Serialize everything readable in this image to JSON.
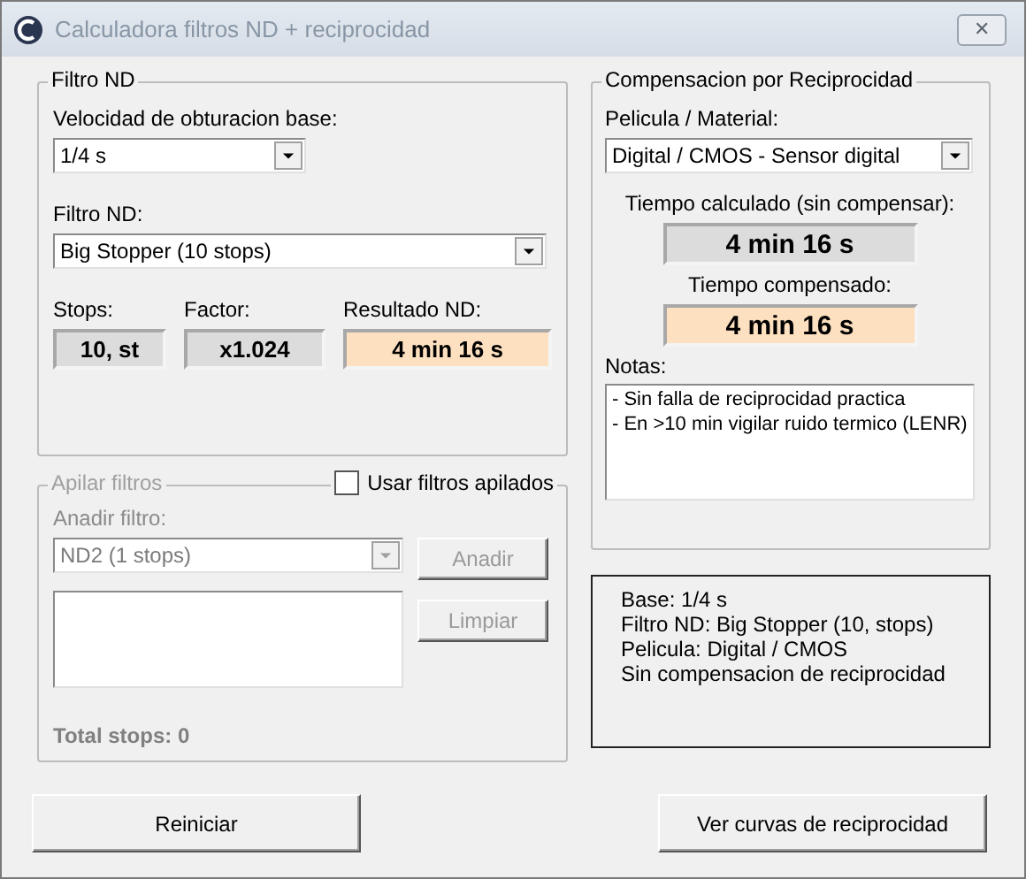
{
  "window": {
    "title": "Calculadora filtros ND + reciprocidad",
    "close": "✕"
  },
  "nd_group": {
    "title": "Filtro ND",
    "shutter_label": "Velocidad de obturacion base:",
    "shutter_value": "1/4 s",
    "filter_label": "Filtro ND:",
    "filter_value": "Big Stopper (10 stops)",
    "outputs": [
      {
        "label": "Stops:",
        "value": "10, st",
        "highlight": false
      },
      {
        "label": "Factor:",
        "value": "x1.024",
        "highlight": false
      },
      {
        "label": "Resultado ND:",
        "value": "4 min 16 s",
        "highlight": true
      }
    ]
  },
  "stack_group": {
    "title": "Apilar filtros",
    "disabled": true,
    "use_checkbox": {
      "label": "Usar filtros apilados",
      "checked": false
    },
    "add_label": "Anadir filtro:",
    "add_value": "ND2 (1 stops)",
    "add_button": "Anadir",
    "clear_button": "Limpiar",
    "total": "Total stops: 0"
  },
  "recip_group": {
    "title": "Compensacion por Reciprocidad",
    "film_label": "Pelicula / Material:",
    "film_value": "Digital / CMOS - Sensor digital",
    "times": [
      {
        "label": "Tiempo calculado (sin compensar):",
        "value": "4 min 16 s",
        "highlight": false
      },
      {
        "label": "Tiempo compensado:",
        "value": "4 min 16 s",
        "highlight": true
      }
    ],
    "notes_label": "Notas:",
    "notes": [
      "- Sin falla de reciprocidad practica",
      "- En >10 min vigilar ruido termico (LENR)"
    ]
  },
  "summary": [
    "Base: 1/4 s",
    "Filtro ND: Big Stopper  (10, stops)",
    "Pelicula: Digital / CMOS",
    "Sin compensacion de reciprocidad"
  ],
  "buttons": {
    "reset": "Reiniciar",
    "curves": "Ver curvas de reciprocidad"
  }
}
